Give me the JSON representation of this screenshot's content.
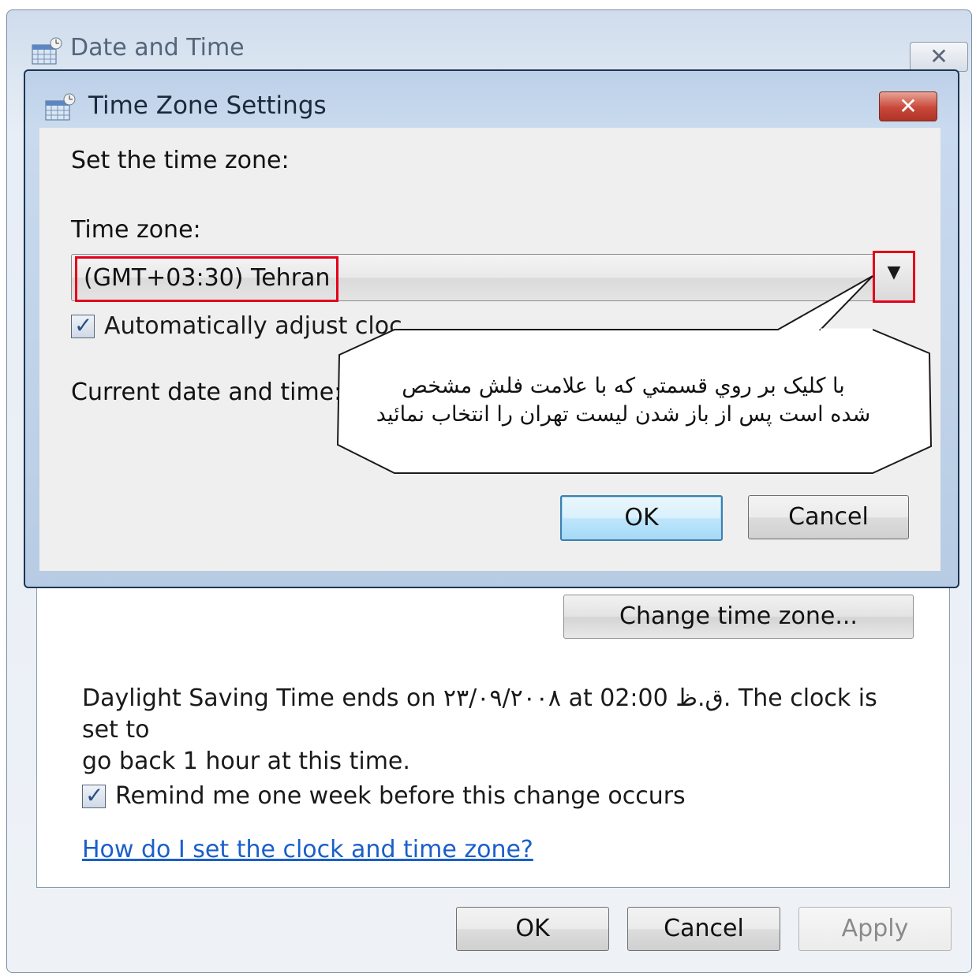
{
  "outer_window": {
    "title": "Date and Time",
    "icon": "calendar-clock-icon",
    "close_label": "✕",
    "change_tz_label": "Change time zone...",
    "dst_text_line1": "Daylight Saving Time ends on ۲۳/۰۹/۲۰۰۸ at 02:00 ق.ظ. The clock is set to",
    "dst_text_line2": "go back 1 hour at this time.",
    "remind_checked": true,
    "remind_label": "Remind me one week before this change occurs",
    "help_link": "How do I set the clock and time zone?",
    "buttons": {
      "ok": "OK",
      "cancel": "Cancel",
      "apply": "Apply"
    }
  },
  "dialog": {
    "title": "Time Zone Settings",
    "icon": "calendar-clock-icon",
    "close_label": "✕",
    "set_label": "Set the time zone:",
    "tz_label": "Time zone:",
    "tz_value": "(GMT+03:30) Tehran",
    "auto_checked": true,
    "auto_label": "Automatically adjust cloc",
    "current_label": "Current date and time:",
    "buttons": {
      "ok": "OK",
      "cancel": "Cancel"
    }
  },
  "callout": {
    "line1": "با کلیک بر روي قسمتي که با علامت فلش مشخص",
    "line2": "شده است پس از باز شدن لیست تهران را انتخاب نمائید"
  },
  "colors": {
    "highlight": "#e3001b",
    "link": "#1a5fc9"
  }
}
